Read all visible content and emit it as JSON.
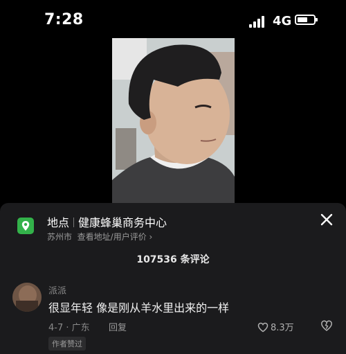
{
  "status_bar": {
    "time": "7:28",
    "network": "4G"
  },
  "location": {
    "label": "地点",
    "name": "健康蜂巢商务中心",
    "city": "苏州市",
    "action": "查看地址/用户评价 ›"
  },
  "comments": {
    "count_text": "107536 条评论",
    "items": [
      {
        "username": "派派",
        "text": "很显年轻  像是刚从羊水里出来的一样",
        "meta": "4-7 · 广东",
        "reply_label": "回复",
        "likes": "8.3万",
        "badge": "作者赞过"
      }
    ]
  },
  "colors": {
    "location_icon": "#33b24a",
    "sheet_bg": "#1b1b1d"
  }
}
